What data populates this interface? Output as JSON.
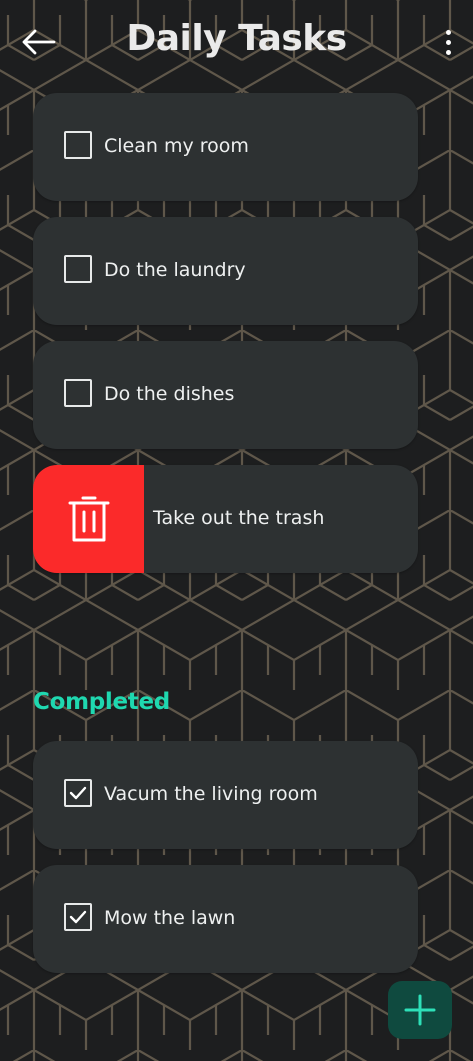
{
  "header": {
    "title": "Daily Tasks",
    "back_icon": "arrow-left-icon",
    "menu_icon": "more-vert-icon"
  },
  "tasks": [
    {
      "label": "Clean my room",
      "checked": false
    },
    {
      "label": "Do the laundry",
      "checked": false
    },
    {
      "label": "Do the dishes",
      "checked": false
    },
    {
      "label": "Take out the trash",
      "checked": false,
      "swiped_delete": true
    }
  ],
  "completed": {
    "title": "Completed",
    "items": [
      {
        "label": "Vacum the living room",
        "checked": true
      },
      {
        "label": "Mow the lawn",
        "checked": true
      }
    ]
  },
  "fab": {
    "icon": "plus-icon"
  },
  "colors": {
    "background": "#1d1e1f",
    "pattern_line": "#6b6151",
    "card": "#2d3132",
    "accent": "#1fd8b0",
    "delete": "#fb2a2a",
    "fab": "#0f4a3f",
    "fab_icon": "#2ee0b8"
  }
}
